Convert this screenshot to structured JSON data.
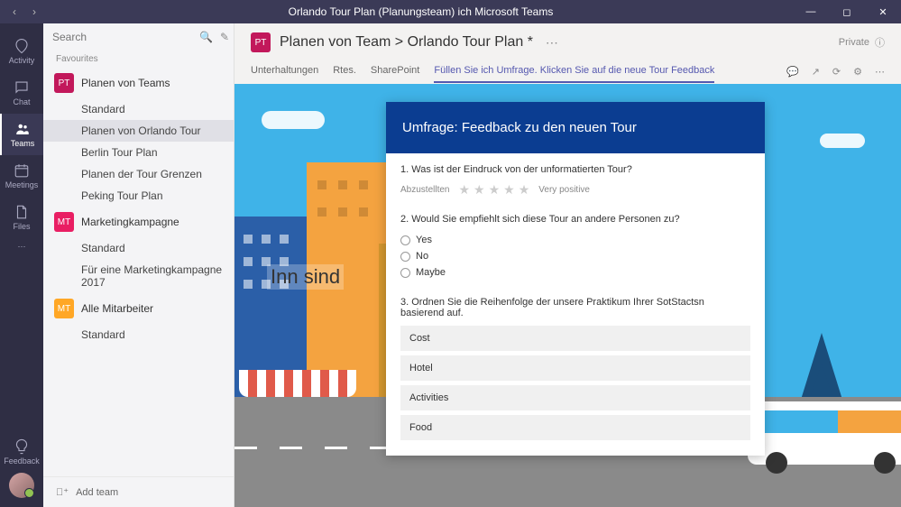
{
  "titlebar": {
    "title": "Orlando Tour Plan (Planungsteam) ich Microsoft Teams"
  },
  "rail": {
    "activity": "Activity",
    "chat": "Chat",
    "teams": "Teams",
    "meetings": "Meetings",
    "files": "Files",
    "feedback": "Feedback"
  },
  "search": {
    "placeholder": "Search"
  },
  "favourites_label": "Favourites",
  "teams": [
    {
      "abbr": "PT",
      "cls": "pt",
      "name": "Planen von Teams",
      "channels": [
        "Standard",
        "Planen von Orlando Tour",
        "Berlin Tour Plan",
        "Planen der Tour Grenzen",
        "Peking Tour Plan"
      ],
      "selected": 1
    },
    {
      "abbr": "MT",
      "cls": "mt",
      "name": "Marketingkampagne",
      "channels": [
        "Standard",
        "Für eine Marketingkampagne 2017"
      ],
      "selected": -1
    },
    {
      "abbr": "MT",
      "cls": "mt2",
      "name": "Alle Mitarbeiter",
      "channels": [
        "Standard"
      ],
      "selected": -1
    }
  ],
  "add_team": "Add team",
  "header": {
    "abbr": "PT",
    "breadcrumb": "Planen von Team > Orlando Tour Plan *",
    "private": "Private"
  },
  "tabs": [
    "Unterhaltungen",
    "Rtes.",
    "SharePoint",
    "Füllen Sie ich Umfrage. Klicken Sie auf die neue Tour Feedback"
  ],
  "active_tab": 3,
  "overlay_text": "Inn sind",
  "survey": {
    "title": "Umfrage: Feedback zu den neuen Tour",
    "q1": {
      "num": "1.",
      "text": "Was ist der Eindruck von der unformatierten Tour?",
      "left": "Abzustellten",
      "right": "Very positive"
    },
    "q2": {
      "num": "2.",
      "text": "Would Sie empfiehlt sich diese Tour an andere Personen zu?",
      "opts": [
        "Yes",
        "No",
        "Maybe"
      ]
    },
    "q3": {
      "num": "3.",
      "text": "Ordnen Sie die Reihenfolge der unsere Praktikum Ihrer SotStactsn basierend auf.",
      "items": [
        "Cost",
        "Hotel",
        "Activities",
        "Food"
      ]
    }
  }
}
